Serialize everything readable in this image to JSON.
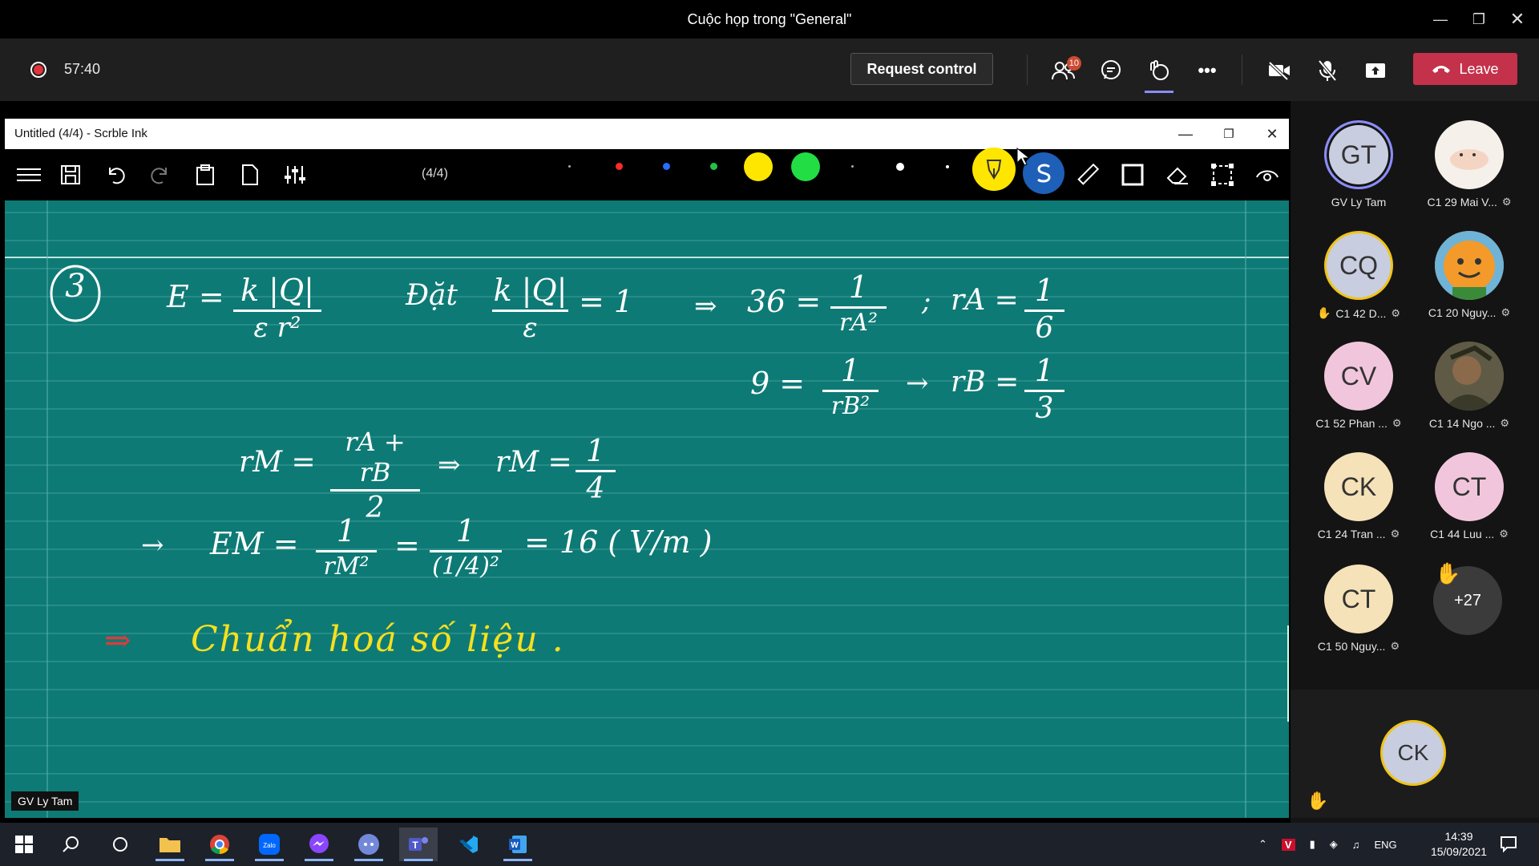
{
  "window": {
    "title": "Cuộc họp trong \"General\""
  },
  "meeting": {
    "timer": "57:40",
    "request_control_label": "Request control",
    "participants_badge": "10",
    "leave_label": "Leave"
  },
  "scrble": {
    "window_title": "Untitled (4/4) - Scrble Ink",
    "page_indicator": "(4/4)",
    "pen_colors": [
      "#ff2a2a",
      "#2b6cff",
      "#22c24a",
      "#ffe600",
      "#22dd44",
      "#ffffff"
    ],
    "presenter_tag": "GV Ly Tam"
  },
  "board": {
    "problem_number": "3",
    "line1_E": "E =",
    "frac1_num": "k |Q|",
    "frac1_den": "ε r²",
    "dat_word": "Đặt",
    "frac2_num": "k |Q|",
    "frac2_den": "ε",
    "eq_one": "= 1",
    "arrow1": "⇒",
    "val36": "36 =",
    "frac3_num": "1",
    "frac3_den": "rA²",
    "semicolon": ";",
    "rA_eq": "rA =",
    "frac4_num": "1",
    "frac4_den": "6",
    "val9": "9 =",
    "frac5_num": "1",
    "frac5_den": "rB²",
    "arrow2": "→",
    "rB_eq": "rB =",
    "frac6_num": "1",
    "frac6_den": "3",
    "rM_eq": "rM =",
    "frac7_num": "rA + rB",
    "frac7_den": "2",
    "arrow3": "⇒",
    "rM_eq2": "rM =",
    "frac8_num": "1",
    "frac8_den": "4",
    "arrow4": "→",
    "EM_eq": "EM =",
    "frac9_num": "1",
    "frac9_den": "rM²",
    "eq2": "=",
    "frac10_num": "1",
    "frac10_den": "(1/4)²",
    "result": "= 16 ( V/m )",
    "conclusion_arrow": "⇒",
    "conclusion": "Chuẩn hoá số liệu ."
  },
  "participants": [
    {
      "initials": "GT",
      "name": "GV Ly Tam",
      "bg": "#c9cde0",
      "muted": false
    },
    {
      "initials": "",
      "name": "C1 29 Mai V...",
      "bg": "#f5f0ea",
      "muted": true,
      "icon": "cat-sticker-avatar"
    },
    {
      "initials": "CQ",
      "name": "C1 42 D...",
      "bg": "#c9cde0",
      "muted": true,
      "hand": true
    },
    {
      "initials": "",
      "name": "C1 20 Nguy...",
      "bg": "#f39a2a",
      "muted": true,
      "icon": "cartoon-avatar"
    },
    {
      "initials": "CV",
      "name": "C1 52 Phan ...",
      "bg": "#f1c6dc",
      "muted": true
    },
    {
      "initials": "",
      "name": "C1 14 Ngo ...",
      "bg": "#7a6b4a",
      "muted": true,
      "icon": "photo-avatar"
    },
    {
      "initials": "CK",
      "name": "C1 24 Tran ...",
      "bg": "#f6e2b8",
      "muted": true
    },
    {
      "initials": "CT",
      "name": "C1 44 Luu ...",
      "bg": "#f1c6dc",
      "muted": true
    },
    {
      "initials": "CT",
      "name": "C1 50 Nguy...",
      "bg": "#f6e2b8",
      "muted": true
    }
  ],
  "more_participants": "+27",
  "self_avatar": "CK",
  "taskbar": {
    "lang": "ENG",
    "time": "14:39",
    "date": "15/09/2021"
  }
}
